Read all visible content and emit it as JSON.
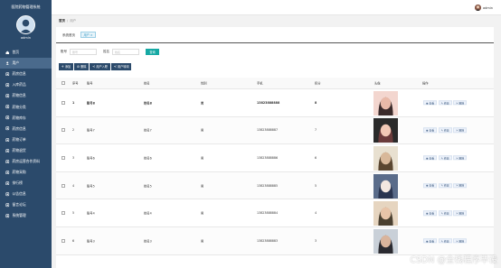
{
  "sidebar": {
    "title": "医院药物管理系统",
    "username": "admin",
    "menu": [
      {
        "label": "首页",
        "icon": "home-icon"
      },
      {
        "label": "用户",
        "icon": "user-icon"
      },
      {
        "label": "药房信息",
        "icon": "pharmacy-icon"
      },
      {
        "label": "入库药品",
        "icon": "stock-in-icon"
      },
      {
        "label": "药物信息",
        "icon": "drug-info-icon"
      },
      {
        "label": "药物分类",
        "icon": "category-icon"
      },
      {
        "label": "药物库存",
        "icon": "inventory-icon"
      },
      {
        "label": "药房信息",
        "icon": "store-icon"
      },
      {
        "label": "药物订单",
        "icon": "order-icon"
      },
      {
        "label": "药物退货",
        "icon": "return-icon"
      },
      {
        "label": "药房运营合作资料",
        "icon": "cooperation-icon"
      },
      {
        "label": "药物采购",
        "icon": "purchase-icon"
      },
      {
        "label": "排行榜",
        "icon": "ranking-icon"
      },
      {
        "label": "公告信息",
        "icon": "notice-icon"
      },
      {
        "label": "留言论坛",
        "icon": "forum-icon"
      },
      {
        "label": "系统管理",
        "icon": "settings-icon"
      }
    ]
  },
  "topbar": {
    "username": "admin"
  },
  "breadcrumb": {
    "home": "首页",
    "current": "用户"
  },
  "tabs": {
    "label": "系统首页",
    "active": "用户"
  },
  "search": {
    "field1_label": "账号",
    "field1_placeholder": "账号",
    "field2_label": "姓名",
    "field2_placeholder": "姓名",
    "button": "查询"
  },
  "actions": [
    {
      "label": "添加",
      "icon": "plus-icon"
    },
    {
      "label": "删除",
      "icon": "trash-icon"
    },
    {
      "label": "用户入职",
      "icon": "export-icon"
    },
    {
      "label": "用户转岗",
      "icon": "transfer-icon"
    }
  ],
  "table": {
    "headers": [
      "序号",
      "账号",
      "姓名",
      "性别",
      "手机",
      "积分",
      "头像",
      "操作"
    ],
    "rows": [
      {
        "no": "1",
        "account": "账号8",
        "name": "姓名8",
        "gender": "男",
        "phone": "13823888888",
        "points": "8",
        "bold": true
      },
      {
        "no": "2",
        "account": "账号7",
        "name": "姓名7",
        "gender": "男",
        "phone": "13823888887",
        "points": "7",
        "bold": false
      },
      {
        "no": "3",
        "account": "账号6",
        "name": "姓名6",
        "gender": "男",
        "phone": "13823888886",
        "points": "6",
        "bold": false
      },
      {
        "no": "4",
        "account": "账号5",
        "name": "姓名5",
        "gender": "男",
        "phone": "13823888885",
        "points": "5",
        "bold": false
      },
      {
        "no": "5",
        "account": "账号4",
        "name": "姓名4",
        "gender": "男",
        "phone": "13823888884",
        "points": "4",
        "bold": false
      },
      {
        "no": "6",
        "account": "账号3",
        "name": "姓名3",
        "gender": "男",
        "phone": "13823888883",
        "points": "3",
        "bold": false
      }
    ],
    "row_actions": [
      {
        "label": "查看",
        "icon": "view-icon"
      },
      {
        "label": "修改",
        "icon": "edit-icon"
      },
      {
        "label": "删除",
        "icon": "delete-icon"
      }
    ]
  },
  "watermark": "CSDN @全栈程序毕设",
  "colors": {
    "sidebar": "#2b4a6b",
    "accent": "#16a9a4",
    "active": "#4a6a8c"
  }
}
